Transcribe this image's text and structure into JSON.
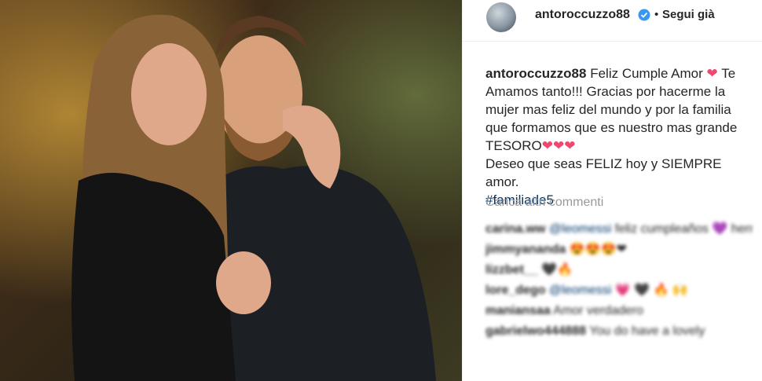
{
  "post": {
    "author": "antoroccuzzo88",
    "follow_label": "Segui già",
    "separator": "•",
    "verified_icon": "verified-badge-icon",
    "accent_color": "#3897f0"
  },
  "caption": {
    "username": "antoroccuzzo88",
    "line1_text": " Feliz Cumple Amor ",
    "heart": "❤",
    "line1_tail": " Te Amamos tanto!!! Gracias por hacerme la mujer mas feliz del mundo y por la familia que formamos que es nuestro mas grande TESORO",
    "hearts": "❤❤❤",
    "line2": "Deseo que seas FELIZ hoy y SIEMPRE amor.",
    "hashtag": "#familiade5"
  },
  "load_more_label": "Carica altri commenti",
  "comments": [
    {
      "user": "carina.ww",
      "mention": "@leomessi",
      "text": " feliz cumpleaños 💜 hermosa familia es lo más importante! Gracias por tanto!"
    },
    {
      "user": "jimmyananda",
      "mention": "",
      "text": " 😍😍😍❤"
    },
    {
      "user": "lizzbet__",
      "mention": "",
      "text": " 🖤🔥"
    },
    {
      "user": "lore_dego",
      "mention": "@leomessi",
      "text": " 💗 🖤 🔥 🙌"
    },
    {
      "user": "maniansaa",
      "mention": "",
      "text": " Amor verdadero"
    },
    {
      "user": "gabrielwo444888",
      "mention": "",
      "text": " You do have a lovely"
    }
  ]
}
